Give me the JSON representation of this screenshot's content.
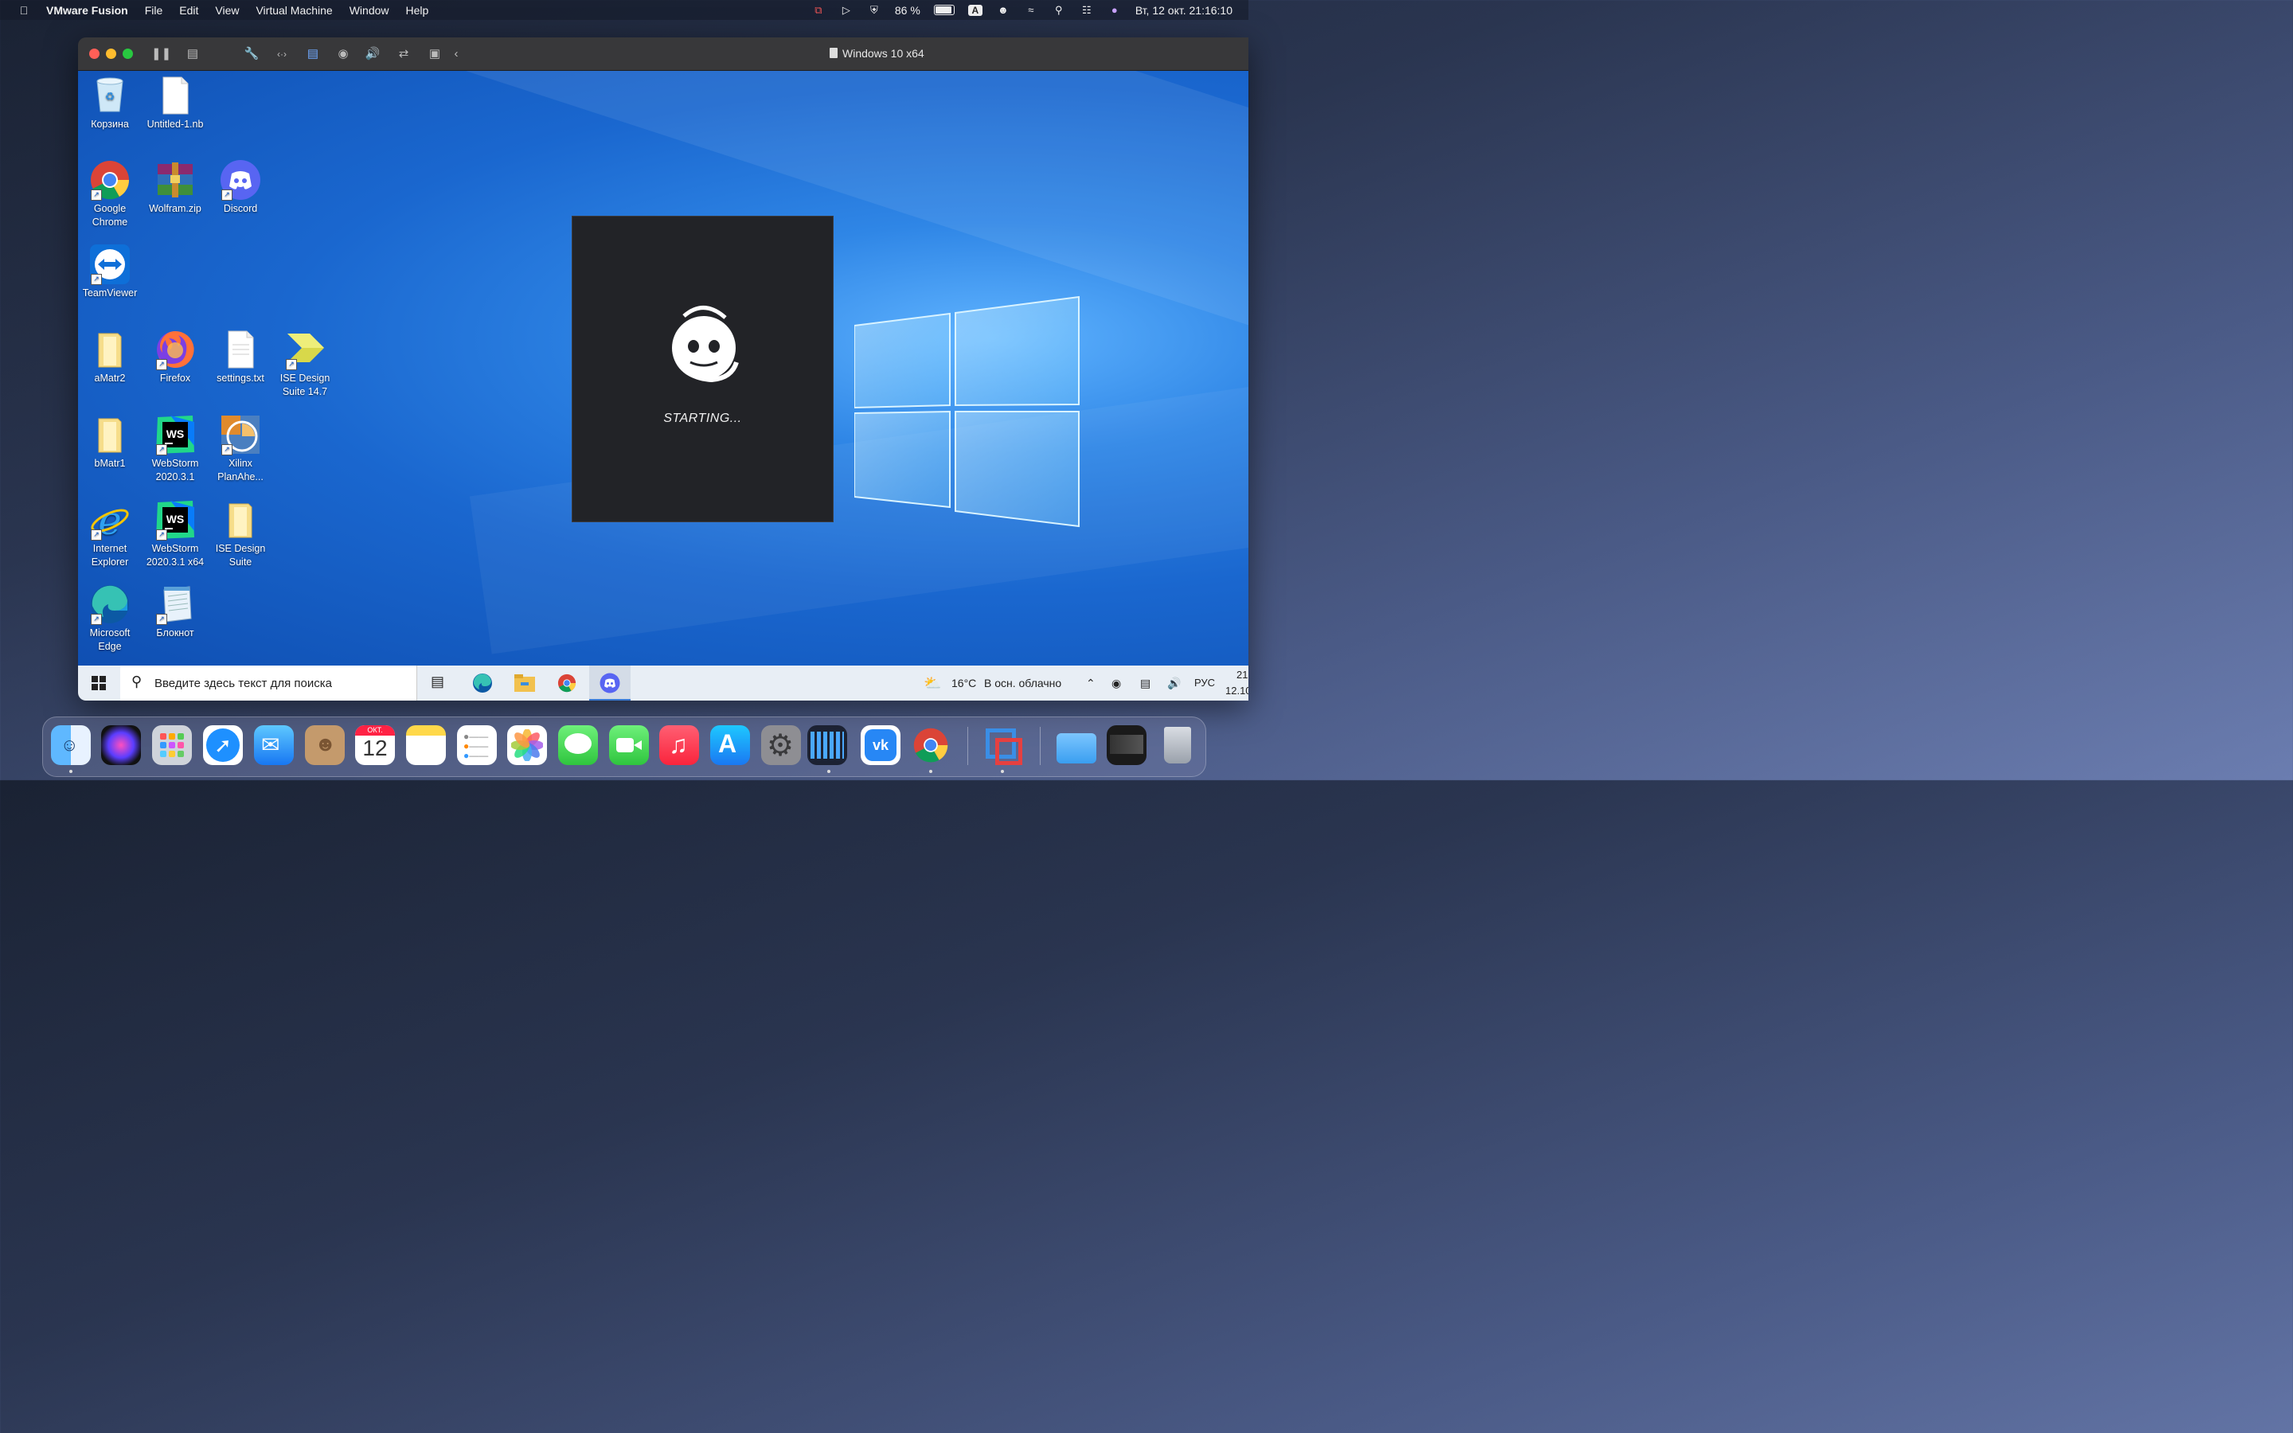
{
  "menubar": {
    "app_name": "VMware Fusion",
    "items": [
      "File",
      "Edit",
      "View",
      "Virtual Machine",
      "Window",
      "Help"
    ],
    "battery": "86 %",
    "input_source": "A",
    "datetime": "Вт, 12 окт.  21:16:10"
  },
  "vm_window": {
    "title": "Windows 10 x64"
  },
  "desktop_icons": [
    {
      "label": "Корзина",
      "icon": "recycle-bin-icon"
    },
    {
      "label": "Untitled-1.nb",
      "icon": "file-icon"
    },
    {
      "label": "Google Chrome",
      "icon": "chrome-icon"
    },
    {
      "label": "Wolfram.zip",
      "icon": "winrar-icon"
    },
    {
      "label": "Discord",
      "icon": "discord-icon"
    },
    {
      "label": "TeamViewer",
      "icon": "teamviewer-icon"
    },
    {
      "label": "aMatr2",
      "icon": "folder-icon"
    },
    {
      "label": "Firefox",
      "icon": "firefox-icon"
    },
    {
      "label": "settings.txt",
      "icon": "text-file-icon"
    },
    {
      "label": "ISE Design Suite 14.7",
      "icon": "ise-icon"
    },
    {
      "label": "bMatr1",
      "icon": "folder-icon"
    },
    {
      "label": "WebStorm 2020.3.1",
      "icon": "webstorm-icon"
    },
    {
      "label": "Xilinx PlanAhe...",
      "icon": "planahead-icon"
    },
    {
      "label": "Internet Explorer",
      "icon": "ie-icon"
    },
    {
      "label": "WebStorm 2020.3.1 x64",
      "icon": "webstorm-icon"
    },
    {
      "label": "ISE Design Suite",
      "icon": "folder-icon"
    },
    {
      "label": "Microsoft Edge",
      "icon": "edge-icon"
    },
    {
      "label": "Блокнот",
      "icon": "notepad-icon"
    }
  ],
  "discord_splash": {
    "status": "STARTING..."
  },
  "taskbar": {
    "search_placeholder": "Введите здесь текст для поиска",
    "weather_temp": "16°C",
    "weather_desc": "В осн. облачно",
    "language": "РУС",
    "clock_time": "21",
    "clock_date": "12.10"
  },
  "dock": {
    "calendar_month": "ОКТ.",
    "calendar_day": "12"
  }
}
